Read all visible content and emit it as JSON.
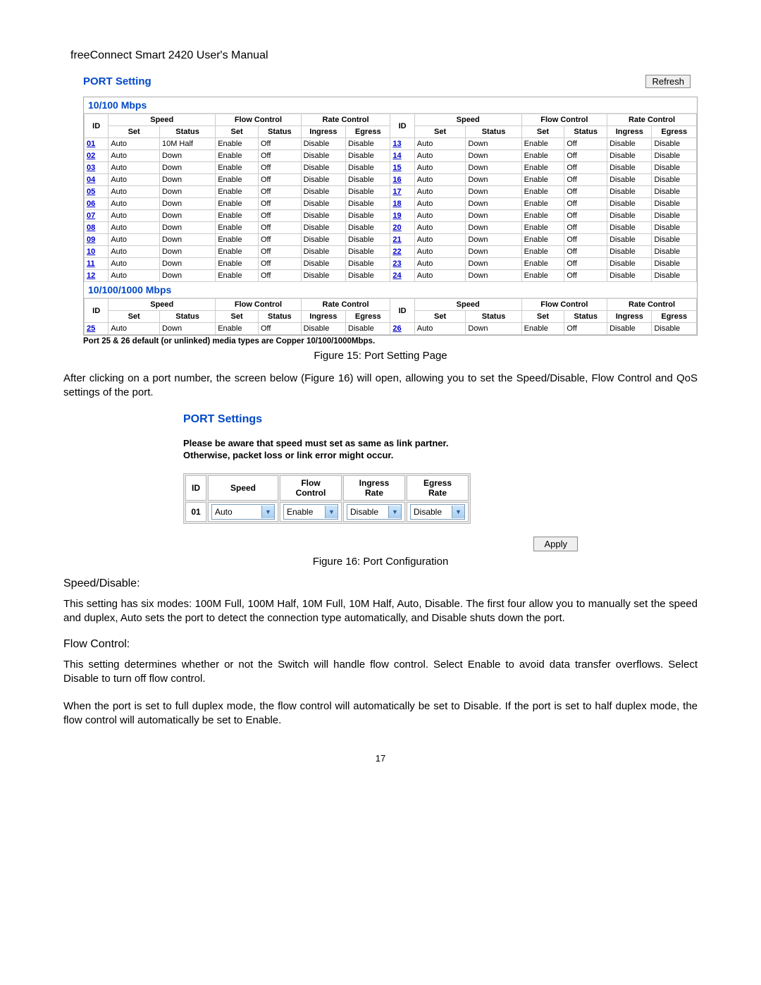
{
  "header": {
    "manual": "freeConnect Smart 2420 User's Manual"
  },
  "section1": {
    "title": "PORT Setting",
    "refresh": "Refresh",
    "group1": "10/100 Mbps",
    "group2": "10/100/1000 Mbps",
    "footnote": "Port 25 & 26 default (or unlinked) media types are Copper 10/100/1000Mbps.",
    "caption": "Figure 15: Port Setting Page",
    "cols": {
      "id": "ID",
      "speed": "Speed",
      "flow": "Flow Control",
      "rate": "Rate Control",
      "set": "Set",
      "status": "Status",
      "ingress": "Ingress",
      "egress": "Egress"
    },
    "left": [
      {
        "id": "01",
        "set": "Auto",
        "status": "10M Half",
        "fc_set": "Enable",
        "fc_status": "Off",
        "ing": "Disable",
        "eg": "Disable"
      },
      {
        "id": "02",
        "set": "Auto",
        "status": "Down",
        "fc_set": "Enable",
        "fc_status": "Off",
        "ing": "Disable",
        "eg": "Disable"
      },
      {
        "id": "03",
        "set": "Auto",
        "status": "Down",
        "fc_set": "Enable",
        "fc_status": "Off",
        "ing": "Disable",
        "eg": "Disable"
      },
      {
        "id": "04",
        "set": "Auto",
        "status": "Down",
        "fc_set": "Enable",
        "fc_status": "Off",
        "ing": "Disable",
        "eg": "Disable"
      },
      {
        "id": "05",
        "set": "Auto",
        "status": "Down",
        "fc_set": "Enable",
        "fc_status": "Off",
        "ing": "Disable",
        "eg": "Disable"
      },
      {
        "id": "06",
        "set": "Auto",
        "status": "Down",
        "fc_set": "Enable",
        "fc_status": "Off",
        "ing": "Disable",
        "eg": "Disable"
      },
      {
        "id": "07",
        "set": "Auto",
        "status": "Down",
        "fc_set": "Enable",
        "fc_status": "Off",
        "ing": "Disable",
        "eg": "Disable"
      },
      {
        "id": "08",
        "set": "Auto",
        "status": "Down",
        "fc_set": "Enable",
        "fc_status": "Off",
        "ing": "Disable",
        "eg": "Disable"
      },
      {
        "id": "09",
        "set": "Auto",
        "status": "Down",
        "fc_set": "Enable",
        "fc_status": "Off",
        "ing": "Disable",
        "eg": "Disable"
      },
      {
        "id": "10",
        "set": "Auto",
        "status": "Down",
        "fc_set": "Enable",
        "fc_status": "Off",
        "ing": "Disable",
        "eg": "Disable"
      },
      {
        "id": "11",
        "set": "Auto",
        "status": "Down",
        "fc_set": "Enable",
        "fc_status": "Off",
        "ing": "Disable",
        "eg": "Disable"
      },
      {
        "id": "12",
        "set": "Auto",
        "status": "Down",
        "fc_set": "Enable",
        "fc_status": "Off",
        "ing": "Disable",
        "eg": "Disable"
      }
    ],
    "right": [
      {
        "id": "13",
        "set": "Auto",
        "status": "Down",
        "fc_set": "Enable",
        "fc_status": "Off",
        "ing": "Disable",
        "eg": "Disable"
      },
      {
        "id": "14",
        "set": "Auto",
        "status": "Down",
        "fc_set": "Enable",
        "fc_status": "Off",
        "ing": "Disable",
        "eg": "Disable"
      },
      {
        "id": "15",
        "set": "Auto",
        "status": "Down",
        "fc_set": "Enable",
        "fc_status": "Off",
        "ing": "Disable",
        "eg": "Disable"
      },
      {
        "id": "16",
        "set": "Auto",
        "status": "Down",
        "fc_set": "Enable",
        "fc_status": "Off",
        "ing": "Disable",
        "eg": "Disable"
      },
      {
        "id": "17",
        "set": "Auto",
        "status": "Down",
        "fc_set": "Enable",
        "fc_status": "Off",
        "ing": "Disable",
        "eg": "Disable"
      },
      {
        "id": "18",
        "set": "Auto",
        "status": "Down",
        "fc_set": "Enable",
        "fc_status": "Off",
        "ing": "Disable",
        "eg": "Disable"
      },
      {
        "id": "19",
        "set": "Auto",
        "status": "Down",
        "fc_set": "Enable",
        "fc_status": "Off",
        "ing": "Disable",
        "eg": "Disable"
      },
      {
        "id": "20",
        "set": "Auto",
        "status": "Down",
        "fc_set": "Enable",
        "fc_status": "Off",
        "ing": "Disable",
        "eg": "Disable"
      },
      {
        "id": "21",
        "set": "Auto",
        "status": "Down",
        "fc_set": "Enable",
        "fc_status": "Off",
        "ing": "Disable",
        "eg": "Disable"
      },
      {
        "id": "22",
        "set": "Auto",
        "status": "Down",
        "fc_set": "Enable",
        "fc_status": "Off",
        "ing": "Disable",
        "eg": "Disable"
      },
      {
        "id": "23",
        "set": "Auto",
        "status": "Down",
        "fc_set": "Enable",
        "fc_status": "Off",
        "ing": "Disable",
        "eg": "Disable"
      },
      {
        "id": "24",
        "set": "Auto",
        "status": "Down",
        "fc_set": "Enable",
        "fc_status": "Off",
        "ing": "Disable",
        "eg": "Disable"
      }
    ],
    "gig_left": [
      {
        "id": "25",
        "set": "Auto",
        "status": "Down",
        "fc_set": "Enable",
        "fc_status": "Off",
        "ing": "Disable",
        "eg": "Disable"
      }
    ],
    "gig_right": [
      {
        "id": "26",
        "set": "Auto",
        "status": "Down",
        "fc_set": "Enable",
        "fc_status": "Off",
        "ing": "Disable",
        "eg": "Disable"
      }
    ]
  },
  "para1": "After clicking on a port number, the screen below (Figure 16) will open, allowing you to set the Speed/Disable, Flow Control and QoS settings of the port.",
  "section2": {
    "title": "PORT Settings",
    "warn1": "Please be aware that speed must set as same as link partner.",
    "warn2": "Otherwise, packet loss or link error might occur.",
    "cols": {
      "id": "ID",
      "speed": "Speed",
      "flow": "Flow\nControl",
      "ingress": "Ingress\nRate",
      "egress": "Egress\nRate"
    },
    "row": {
      "id": "01",
      "speed": "Auto",
      "flow": "Enable",
      "ingress": "Disable",
      "egress": "Disable"
    },
    "apply": "Apply",
    "caption": "Figure 16: Port Configuration"
  },
  "speed_h": "Speed/Disable:",
  "speed_p": "This setting has six modes: 100M Full, 100M Half, 10M Full, 10M Half, Auto, Disable.  The first four allow you to manually set the speed and duplex, Auto sets the port to detect the connection type automatically, and Disable shuts down the port.",
  "flow_h": "Flow Control:",
  "flow_p1": "This setting determines whether or not the Switch will handle flow control. Select Enable to avoid data transfer overflows. Select Disable to turn off flow control.",
  "flow_p2": "When the port is set to full duplex mode, the flow control will automatically be set to Disable.  If the port is set to half duplex mode, the flow control will automatically be set to Enable.",
  "pagenum": "17"
}
